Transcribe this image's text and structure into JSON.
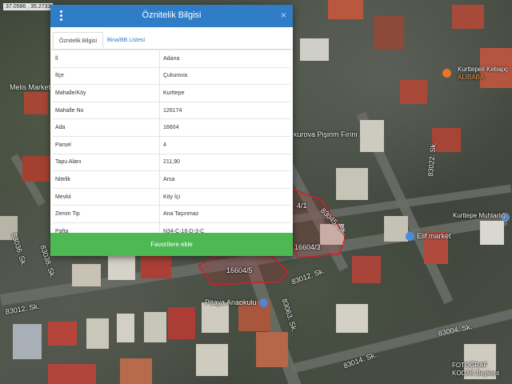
{
  "map": {
    "coords": "37.0586 , 35.2733",
    "labels": {
      "melis_market": "Melis Market",
      "kurttepeli": "Kurttepeli Kebapç",
      "alibaba": "ALİBABA",
      "firin": "kurova Pişirim Fırını",
      "muhtarlik": "Kurttepe Muhtarlığı",
      "elif_market": "Elif market",
      "anaokulu": "Pitaya Anaokulu",
      "fotograf": "FOTOĞRAF",
      "kodak": "KODAK Beykent",
      "sk_83045": "83045. Sk.",
      "sk_83022": "83022. Sk.",
      "sk_83036": "83036. Sk.",
      "sk_83038": "83038. Sk.",
      "sk_83012_a": "83012. Sk.",
      "sk_83012_b": "83012. Sk.",
      "sk_83063": "83063. Sk.",
      "sk_83014": "83014. Sk.",
      "sk_83004": "83004. Sk.",
      "parcel_1": "16604/3",
      "parcel_2": "16604/5",
      "parcel_3": "4/1"
    }
  },
  "dialog": {
    "title": "Öznitelik Bilgisi",
    "close": "×",
    "tabs": [
      "Öznitelik Bilgisi",
      "Bina/BB Listesi"
    ],
    "rows": [
      {
        "key": "İl",
        "value": "Adana"
      },
      {
        "key": "İlçe",
        "value": "Çukurova"
      },
      {
        "key": "Mahalle/Köy",
        "value": "Kurttepe"
      },
      {
        "key": "Mahalle No",
        "value": "126174"
      },
      {
        "key": "Ada",
        "value": "16604"
      },
      {
        "key": "Parsel",
        "value": "4"
      },
      {
        "key": "Tapu Alanı",
        "value": "211,90"
      },
      {
        "key": "Nitelik",
        "value": "Arsa"
      },
      {
        "key": "Mevkii",
        "value": "Köy İçi"
      },
      {
        "key": "Zemin Tip",
        "value": "Ana Taşınmaz"
      },
      {
        "key": "Pafta",
        "value": "N34-C-16-D-3-C"
      }
    ],
    "favorite_button": "Favorilere ekle"
  }
}
